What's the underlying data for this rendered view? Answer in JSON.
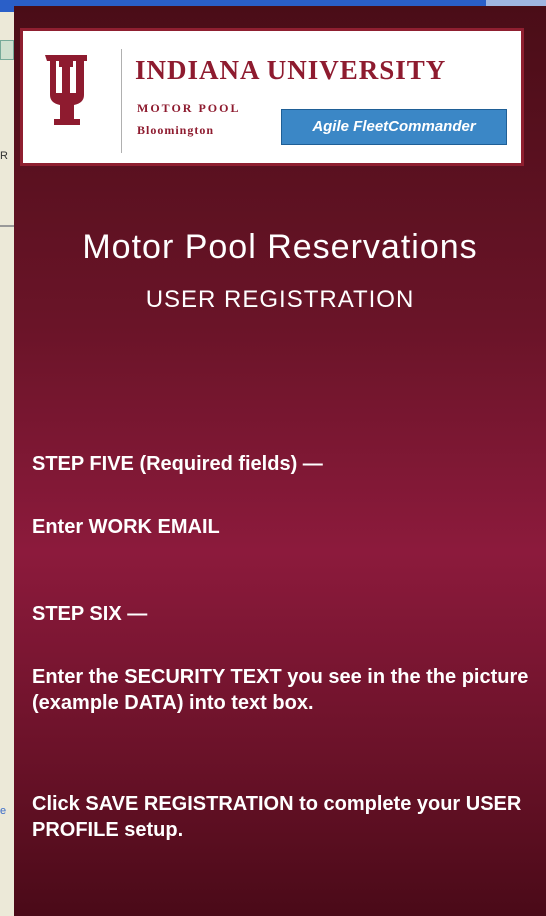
{
  "banner": {
    "university": "INDIANA UNIVERSITY",
    "department": "MOTOR POOL",
    "campus": "Bloomington",
    "product": "Agile FleetCommander",
    "brand_color": "#8e1b2f",
    "badge_color": "#3b87c6"
  },
  "header": {
    "title": "Motor Pool Reservations",
    "subtitle": "USER REGISTRATION"
  },
  "instructions": {
    "step5_heading": "STEP FIVE (Required fields) —",
    "step5_text": "Enter  WORK EMAIL",
    "step6_heading": "STEP SIX  —",
    "step6_text": "Enter  the SECURITY  TEXT you see in the the picture (example DATA) into text box.",
    "save_text": "Click SAVE REGISTRATION to complete your USER PROFILE setup."
  },
  "background": {
    "partial_char": "R",
    "partial_icon": "e"
  }
}
